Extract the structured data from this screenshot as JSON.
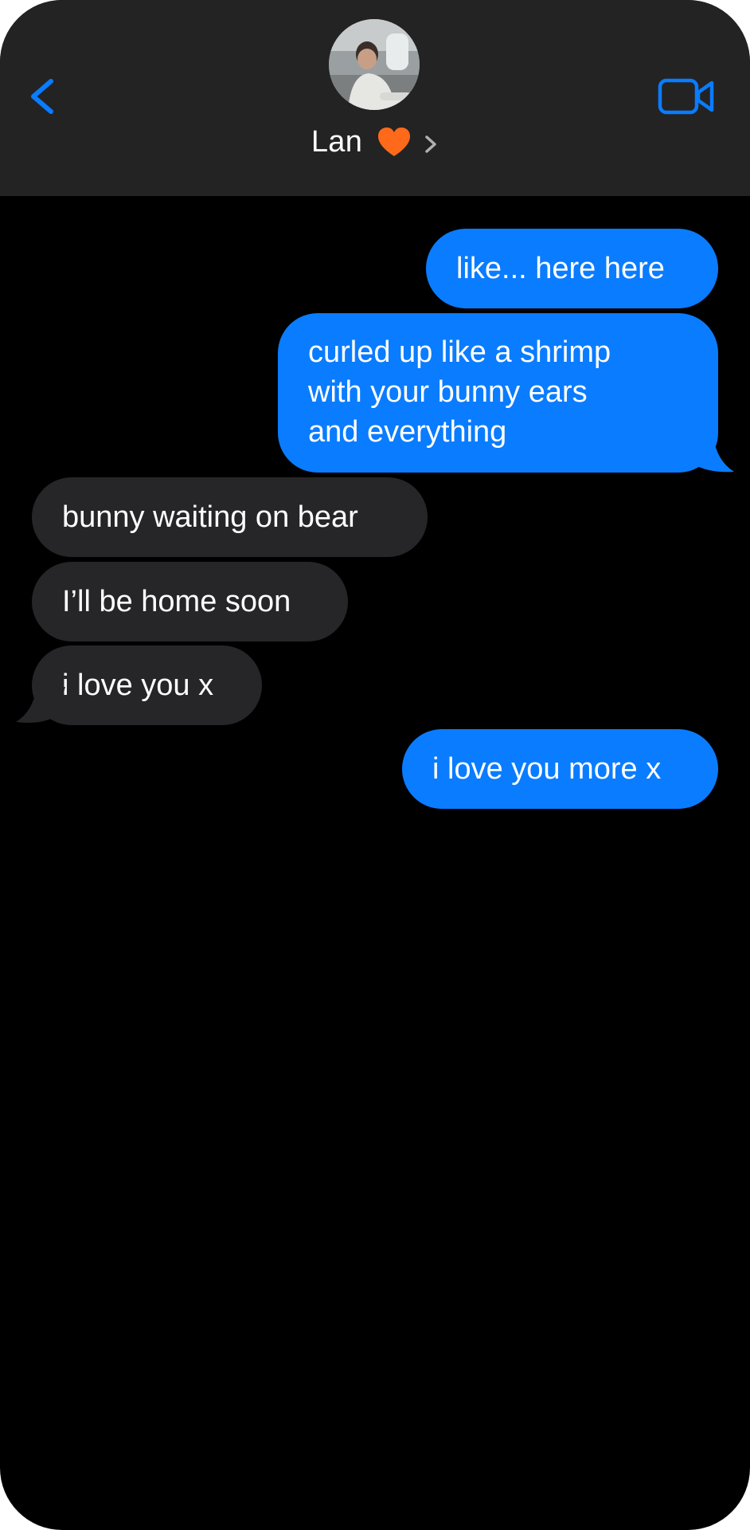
{
  "header": {
    "contact_name": "Lan",
    "contact_emoji": "🧡",
    "back_icon": "chevron-left-icon",
    "video_icon": "video-camera-icon",
    "accent_color": "#0a7cff"
  },
  "messages": [
    {
      "direction": "sent",
      "lines": [
        "like... here here"
      ]
    },
    {
      "direction": "sent",
      "lines": [
        "curled up like a shrimp",
        "with your bunny ears",
        "and everything"
      ]
    },
    {
      "direction": "received",
      "lines": [
        "bunny waiting on bear"
      ]
    },
    {
      "direction": "received",
      "lines": [
        "I’ll be home soon"
      ]
    },
    {
      "direction": "received",
      "lines": [
        "i love you x"
      ]
    },
    {
      "direction": "sent",
      "lines": [
        "i love you more x"
      ]
    }
  ],
  "colors": {
    "sent_bubble": "#0a7cff",
    "received_bubble": "#262629",
    "header_bg": "#232323",
    "background": "#000000",
    "heart": "#ff6a1a"
  }
}
